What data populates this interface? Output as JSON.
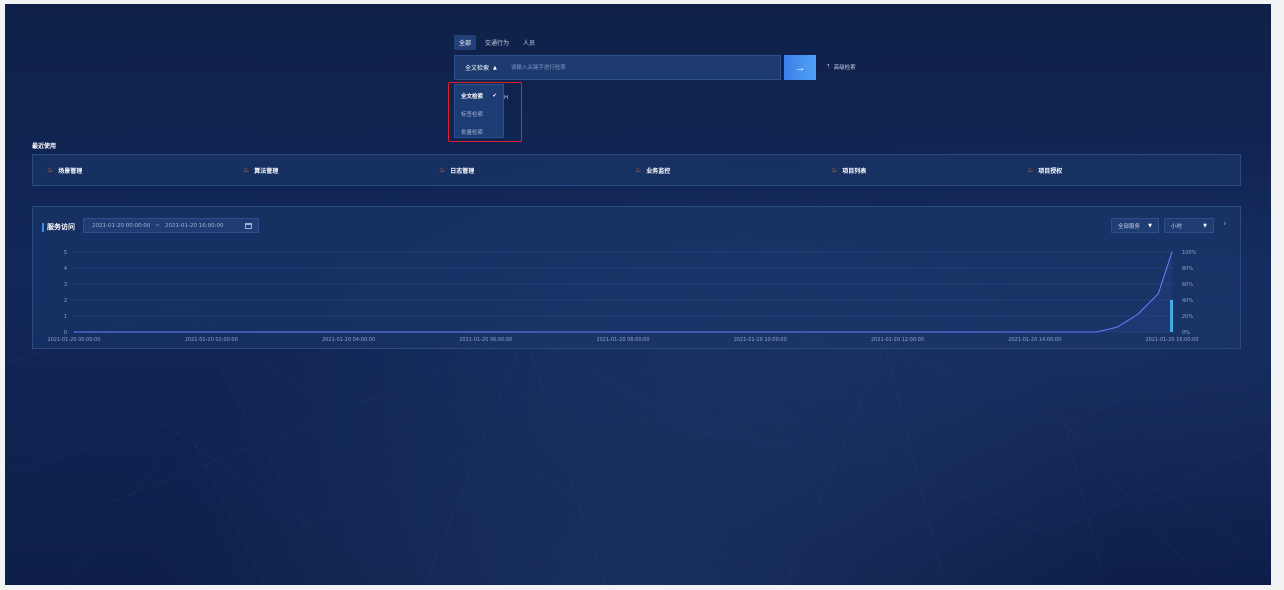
{
  "search": {
    "tabs": [
      {
        "label": "全部",
        "active": true
      },
      {
        "label": "交通行为",
        "active": false
      },
      {
        "label": "人员",
        "active": false
      }
    ],
    "type_label": "全文检索",
    "type_caret": "▲",
    "placeholder": "请输入关键字进行检索",
    "go_arrow": "→",
    "advanced_label": "高级检索",
    "advanced_icon": "⇡",
    "dropdown": {
      "items": [
        {
          "label": "全文检索",
          "selected": true
        },
        {
          "label": "标签检索",
          "selected": false
        },
        {
          "label": "批量检索",
          "selected": false
        }
      ],
      "check": "✔",
      "peek": "H"
    }
  },
  "recent": {
    "title": "最近使用",
    "icon": "fire-icon",
    "fire_glyph": "♨",
    "items": [
      "场景管理",
      "算法管理",
      "日志管理",
      "业务监控",
      "项目列表",
      "项目授权"
    ]
  },
  "service": {
    "title": "服务访问",
    "date_start": "2021-01-20 00:00:00",
    "date_sep": "~",
    "date_end": "2021-01-20 16:00:00",
    "select_service": "全部服务",
    "select_unit": "小时",
    "caret": "▼",
    "next": "›"
  },
  "colors": {
    "line": "#6b7fff",
    "bar": "#3fb2e6",
    "grid": "#2a4a82"
  },
  "chart_data": {
    "type": "line",
    "x": [
      "2021-01-20 00:00:00",
      "2021-01-20 02:00:00",
      "2021-01-20 04:00:00",
      "2021-01-20 06:00:00",
      "2021-01-20 08:00:00",
      "2021-01-20 10:00:00",
      "2021-01-20 12:00:00",
      "2021-01-20 14:00:00",
      "2021-01-20 16:00:00"
    ],
    "y_left_ticks": [
      "0",
      "1",
      "2",
      "3",
      "4",
      "5"
    ],
    "y_right_ticks": [
      "0%",
      "20%",
      "40%",
      "60%",
      "80%",
      "100%"
    ],
    "ylim": [
      0,
      5
    ],
    "series": [
      {
        "type": "line",
        "points": [
          [
            0,
            0
          ],
          [
            14.9,
            0
          ],
          [
            15.2,
            0.3
          ],
          [
            15.5,
            1.1
          ],
          [
            15.8,
            2.4
          ],
          [
            16,
            5
          ]
        ]
      },
      {
        "type": "bar",
        "points": [
          [
            16,
            2
          ]
        ]
      }
    ],
    "grid": true
  }
}
